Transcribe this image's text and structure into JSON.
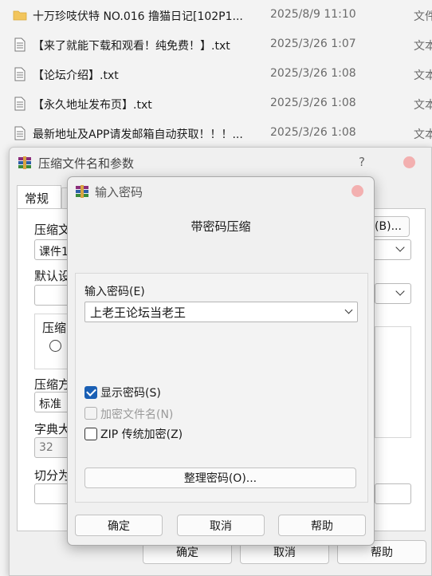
{
  "files": [
    {
      "icon": "folder-icon",
      "name": "十万珍吱伏特 NO.016 撸猫日记[102P1...",
      "date": "2025/8/9 11:10",
      "type": "文件"
    },
    {
      "icon": "text-file-icon",
      "name": "【来了就能下载和观看！纯免费！】.txt",
      "date": "2025/3/26 1:07",
      "type": "文本"
    },
    {
      "icon": "text-file-icon",
      "name": "【论坛介绍】.txt",
      "date": "2025/3/26 1:08",
      "type": "文本"
    },
    {
      "icon": "text-file-icon",
      "name": "【永久地址发布页】.txt",
      "date": "2025/3/26 1:08",
      "type": "文本"
    },
    {
      "icon": "text-file-icon",
      "name": "最新地址及APP请发邮箱自动获取！！！...",
      "date": "2025/3/26 1:08",
      "type": "文本"
    }
  ],
  "archive_dialog": {
    "title": "压缩文件名和参数",
    "help_mark": "?",
    "tab_general": "常规",
    "archive_name_label": "压缩文",
    "archive_name_value": "课件1",
    "browse_button": "(B)...",
    "default_profile_label": "默认设",
    "format_group_label": "压缩",
    "method_label": "压缩方",
    "method_value": "标准",
    "dict_label": "字典大",
    "dict_value": "32",
    "split_label": "切分为",
    "ok_button": "确定",
    "cancel_button": "取消",
    "help_button": "帮助"
  },
  "password_dialog": {
    "title": "输入密码",
    "subtitle": "带密码压缩",
    "password_label": "输入密码(E)",
    "password_value": "上老王论坛当老王",
    "show_password_label": "显示密码(S)",
    "show_password_checked": true,
    "encrypt_names_label": "加密文件名(N)",
    "encrypt_names_checked": false,
    "zip_legacy_label": "ZIP 传统加密(Z)",
    "zip_legacy_checked": false,
    "organize_button": "整理密码(O)...",
    "ok_button": "确定",
    "cancel_button": "取消",
    "help_button": "帮助"
  },
  "colors": {
    "accent": "#1a5fb4",
    "folder": "#f2c55c",
    "close": "#f3b0b0"
  }
}
